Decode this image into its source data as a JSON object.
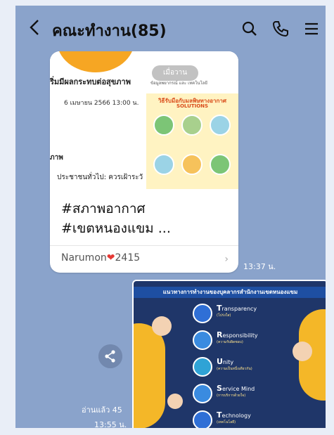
{
  "header": {
    "title": "คณะทำงาน(85)",
    "back_icon": "chevron-left-icon",
    "search_icon": "search-icon",
    "call_icon": "phone-icon",
    "menu_icon": "menu-icon"
  },
  "messages": {
    "shared_post": {
      "thumb_left_headline": "ริ่มมีผลกระทบต่อสุขภาพ",
      "thumb_left_date": "6 เมษายน 2566 13:00 น.",
      "thumb_left_label": "ภาพ",
      "thumb_left_sub": "ประชาชนทั่วไป: ควรเฝ้าระวั",
      "thumb_right_more": "เมื่อวาน",
      "thumb_right_ceo": "ข้อมูลพยากรณ์ และ เทคโนโลยี",
      "thumb_right_poster_title": "วิธีรับมือกับมลพิษทางอากาศ",
      "thumb_right_poster_sub": "SOLUTIONS",
      "text_line1": "#สภาพอากาศ",
      "text_line2": "#เขตหนองแขม ...",
      "author": "Narumon",
      "author_suffix": "2415",
      "time": "13:37 น."
    },
    "image_post": {
      "title": "แนวทางการทำงานของบุคลากรสำนักงานเขตหนองแขม",
      "values": [
        {
          "letter": "T",
          "rest": "ransparency",
          "desc": "(โปร่งใส)"
        },
        {
          "letter": "R",
          "rest": "esponsibility",
          "desc": "(ความรับผิดชอบ)"
        },
        {
          "letter": "U",
          "rest": "nity",
          "desc": "(ความเป็นหนึ่งเดียวกัน)"
        },
        {
          "letter": "S",
          "rest": "ervice Mind",
          "desc": "(การบริการด้วยใจ)"
        },
        {
          "letter": "T",
          "rest": "echnology",
          "desc": "(เทคโนโลยี)"
        }
      ],
      "read_status": "อ่านแล้ว 45",
      "time": "13:55 น."
    }
  },
  "colors": {
    "chat_bg": "#8aa3cb",
    "accent": "#1e4fa2",
    "yellow": "#f4b728"
  }
}
